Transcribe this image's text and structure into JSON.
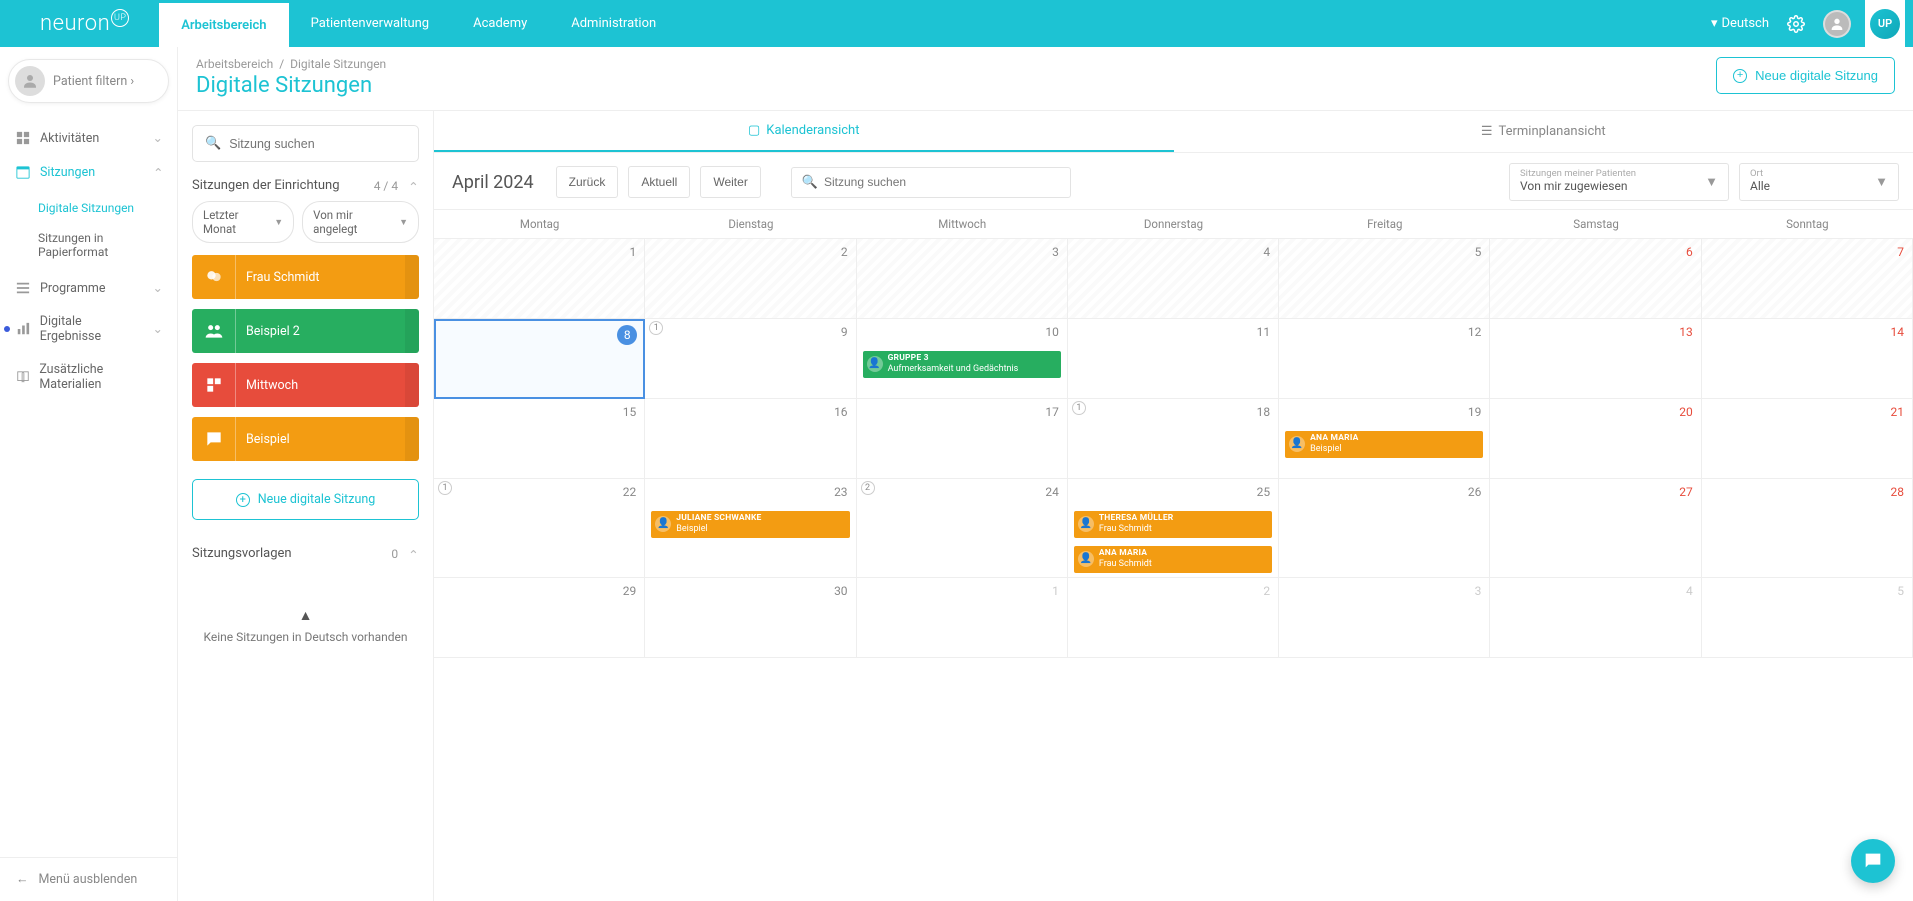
{
  "brand": {
    "name": "neuron",
    "up": "UP"
  },
  "nav": {
    "items": [
      "Arbeitsbereich",
      "Patientenverwaltung",
      "Academy",
      "Administration"
    ],
    "language": "Deutsch"
  },
  "sidebar": {
    "patient_filter": "Patient filtern ›",
    "items": [
      {
        "label": "Aktivitäten",
        "icon": "grid"
      },
      {
        "label": "Sitzungen",
        "icon": "calendar",
        "open": true
      },
      {
        "label": "Programme",
        "icon": "list"
      },
      {
        "label": "Digitale Ergebnisse",
        "icon": "bar",
        "dot": true
      },
      {
        "label": "Zusätzliche Materialien",
        "icon": "book"
      }
    ],
    "submenu": [
      "Digitale Sitzungen",
      "Sitzungen in Papierformat"
    ],
    "hide_menu": "Menü ausblenden"
  },
  "panel": {
    "search_placeholder": "Sitzung suchen",
    "sec_title": "Sitzungen der Einrichtung",
    "sec_count": "4 / 4",
    "filter1": "Letzter Monat",
    "filter2": "Von mir angelegt",
    "cards": [
      {
        "label": "Frau Schmidt",
        "color": "orange",
        "icon": "brain"
      },
      {
        "label": "Beispiel 2",
        "color": "green",
        "icon": "people"
      },
      {
        "label": "Mittwoch",
        "color": "red",
        "icon": "blocks"
      },
      {
        "label": "Beispiel",
        "color": "orange",
        "icon": "chat"
      }
    ],
    "new_session": "Neue digitale Sitzung",
    "templates_title": "Sitzungsvorlagen",
    "templates_count": "0",
    "warn": "Keine Sitzungen in Deutsch vorhanden"
  },
  "header": {
    "crumb1": "Arbeitsbereich",
    "crumb2": "Digitale Sitzungen",
    "title": "Digitale Sitzungen",
    "new_btn": "Neue digitale Sitzung"
  },
  "views": {
    "calendar": "Kalenderansicht",
    "schedule": "Terminplanansicht"
  },
  "toolbar": {
    "month": "April 2024",
    "back": "Zurück",
    "today": "Aktuell",
    "next": "Weiter",
    "search_placeholder": "Sitzung suchen",
    "select1_label": "Sitzungen meiner Patienten",
    "select1_value": "Von mir zugewiesen",
    "select2_label": "Ort",
    "select2_value": "Alle"
  },
  "calendar": {
    "days": [
      "Montag",
      "Dienstag",
      "Mittwoch",
      "Donnerstag",
      "Freitag",
      "Samstag",
      "Sonntag"
    ],
    "weeks": [
      [
        {
          "n": "1",
          "prev": true
        },
        {
          "n": "2",
          "prev": true
        },
        {
          "n": "3",
          "prev": true
        },
        {
          "n": "4",
          "prev": true
        },
        {
          "n": "5",
          "prev": true
        },
        {
          "n": "6",
          "prev": true,
          "we": true
        },
        {
          "n": "7",
          "prev": true,
          "we": true
        }
      ],
      [
        {
          "n": "8",
          "today": true
        },
        {
          "n": "9",
          "badge": "1"
        },
        {
          "n": "10",
          "events": [
            {
              "c": "green",
              "l1": "GRUPPE 3",
              "l2": "Aufmerksamkeit und Gedächtnis"
            }
          ]
        },
        {
          "n": "11"
        },
        {
          "n": "12"
        },
        {
          "n": "13",
          "we": true
        },
        {
          "n": "14",
          "we": true
        }
      ],
      [
        {
          "n": "15"
        },
        {
          "n": "16"
        },
        {
          "n": "17"
        },
        {
          "n": "18",
          "badge": "1"
        },
        {
          "n": "19",
          "events": [
            {
              "c": "orange",
              "l1": "ANA MARIA",
              "l2": "Beispiel"
            }
          ]
        },
        {
          "n": "20",
          "we": true
        },
        {
          "n": "21",
          "we": true
        }
      ],
      [
        {
          "n": "22",
          "badge": "1"
        },
        {
          "n": "23",
          "events": [
            {
              "c": "orange",
              "l1": "JULIANE SCHWANKE",
              "l2": "Beispiel"
            }
          ]
        },
        {
          "n": "24",
          "badge": "2"
        },
        {
          "n": "25",
          "events": [
            {
              "c": "orange",
              "l1": "THERESA MÜLLER",
              "l2": "Frau Schmidt",
              "bump": true
            },
            {
              "c": "orange",
              "l1": "ANA MARIA",
              "l2": "Frau Schmidt",
              "bump": true
            }
          ]
        },
        {
          "n": "26"
        },
        {
          "n": "27",
          "we": true
        },
        {
          "n": "28",
          "we": true
        }
      ],
      [
        {
          "n": "29"
        },
        {
          "n": "30"
        },
        {
          "n": "1",
          "other": true
        },
        {
          "n": "2",
          "other": true
        },
        {
          "n": "3",
          "other": true
        },
        {
          "n": "4",
          "other": true,
          "we": false
        },
        {
          "n": "5",
          "other": true,
          "we": false
        }
      ]
    ]
  }
}
